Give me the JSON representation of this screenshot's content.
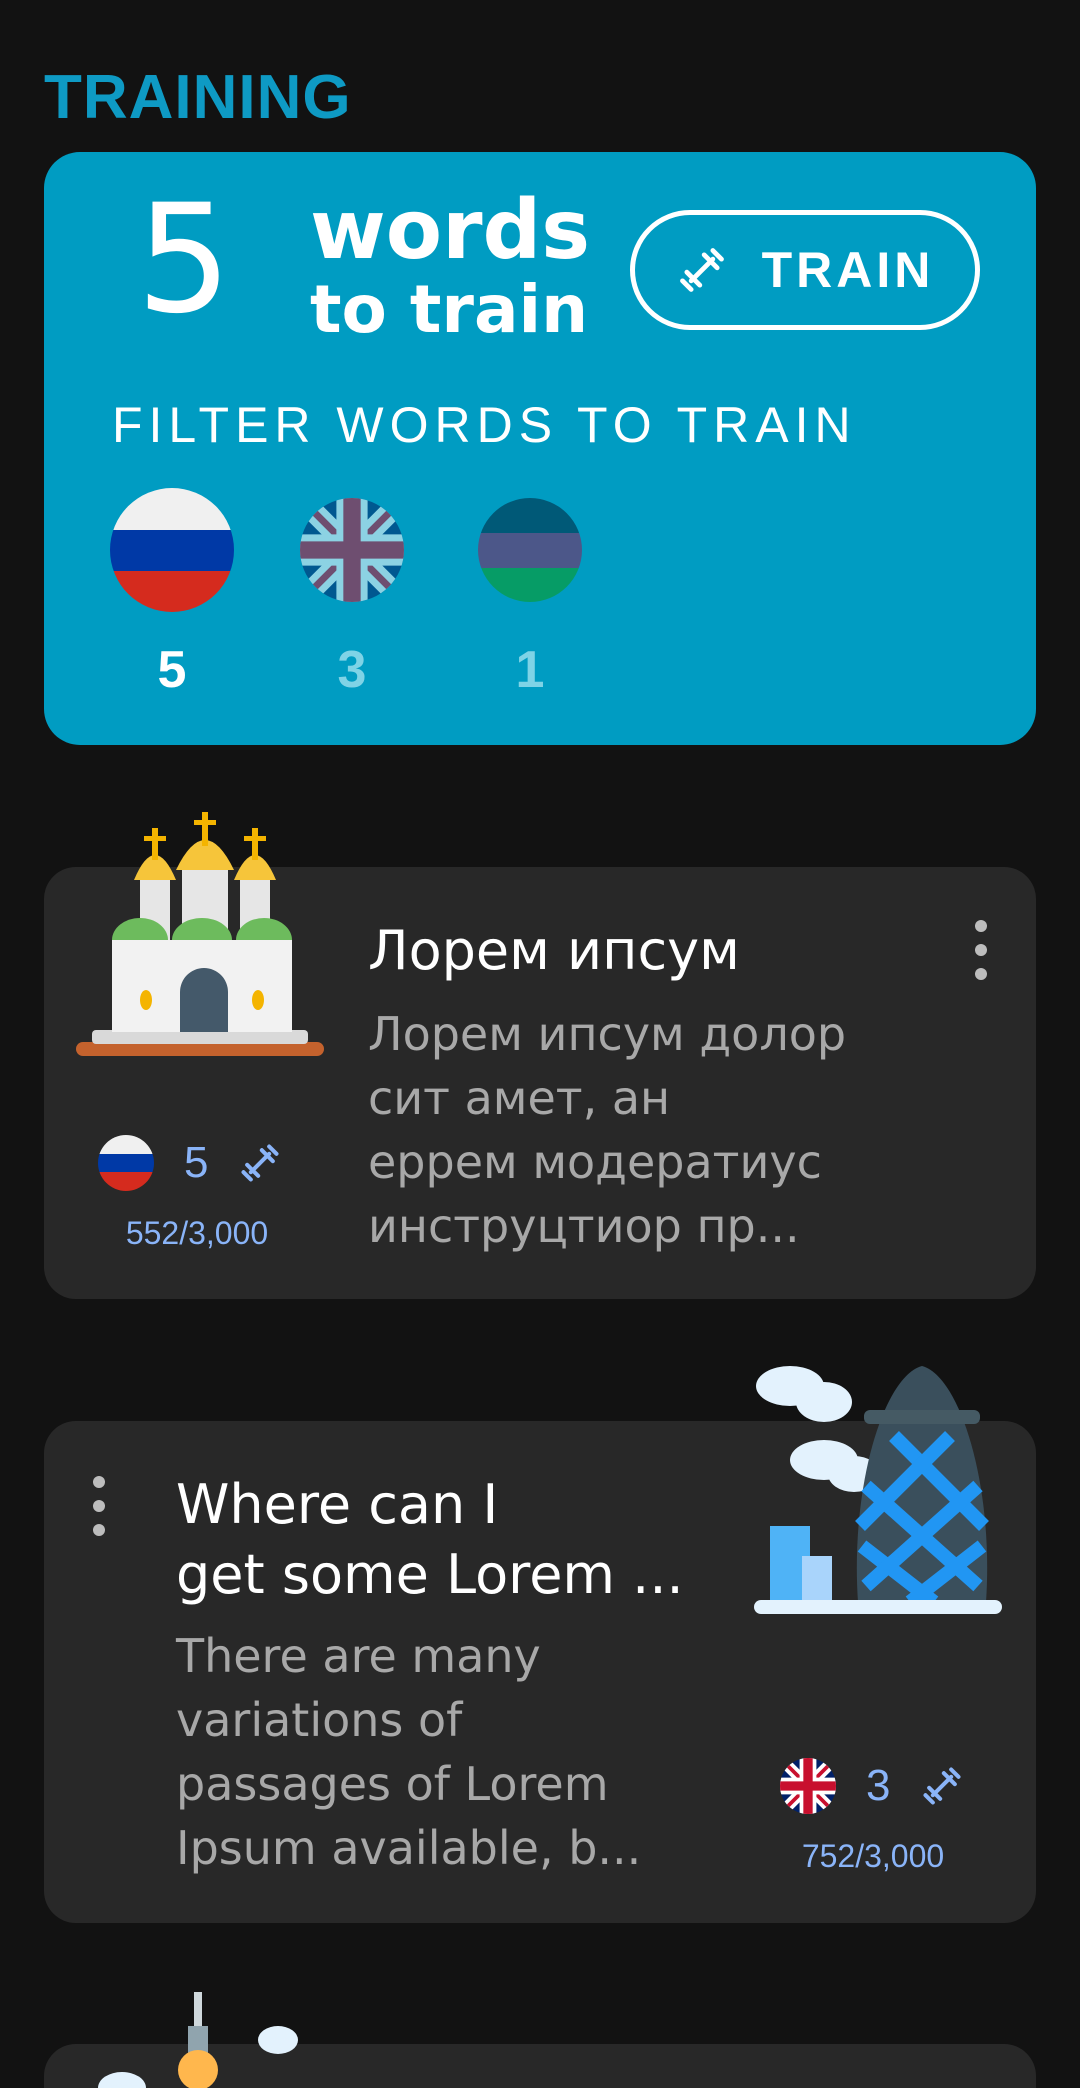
{
  "section_title": "TRAINING",
  "train_card": {
    "count": "5",
    "words_label": "words",
    "to_train_label": "to train",
    "train_button_label": "TRAIN",
    "filter_title": "FILTER WORDS TO TRAIN",
    "filters": [
      {
        "flag": "russia-flag-icon",
        "count": "5",
        "selected": true
      },
      {
        "flag": "uk-flag-icon",
        "count": "3",
        "selected": false
      },
      {
        "flag": "tricolor-flag-icon",
        "count": "1",
        "selected": false
      }
    ]
  },
  "books": [
    {
      "title": "Лорем ипсум",
      "description_lines": [
        "Лорем ипсум долор",
        "сит амет, ан",
        "еррем модератиус",
        "инструцтиор пр..."
      ],
      "illustration": "church-illustration",
      "flag": "russia-flag-icon",
      "words_to_train": "5",
      "progress": "552/3,000"
    },
    {
      "title_lines": [
        "Where can I",
        "get some Lorem ..."
      ],
      "description_lines": [
        "There are many",
        "variations of",
        "passages of Lorem",
        "Ipsum available, b..."
      ],
      "illustration": "gherkin-tower-illustration",
      "flag": "uk-flag-icon",
      "words_to_train": "3",
      "progress": "752/3,000"
    }
  ],
  "colors": {
    "accent": "#009cc2",
    "section_title": "#0e9ac4",
    "card_bg": "#282828",
    "stat_text": "#8ab4f8",
    "unselected_count": "#7fd3e6"
  }
}
